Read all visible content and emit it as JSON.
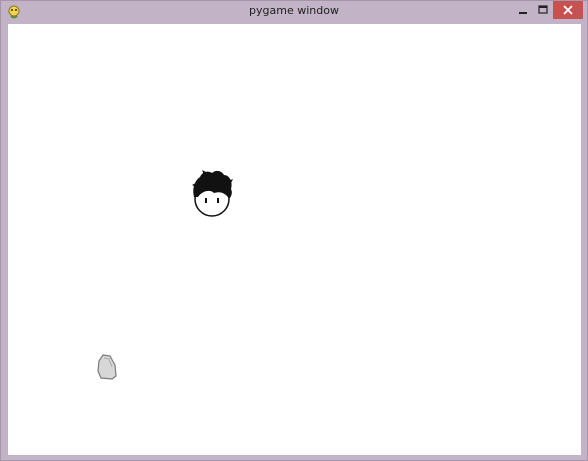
{
  "window": {
    "title": "pygame window"
  },
  "icons": {
    "app": "pygame-snake-icon",
    "minimize": "minimize-icon",
    "maximize": "maximize-icon",
    "close": "close-icon"
  },
  "colors": {
    "frame": "#c3b3c6",
    "client_background": "#ffffff",
    "close_button": "#c75050"
  },
  "game": {
    "sprites": [
      {
        "name": "player-head-sprite"
      },
      {
        "name": "rock-sprite"
      }
    ]
  }
}
